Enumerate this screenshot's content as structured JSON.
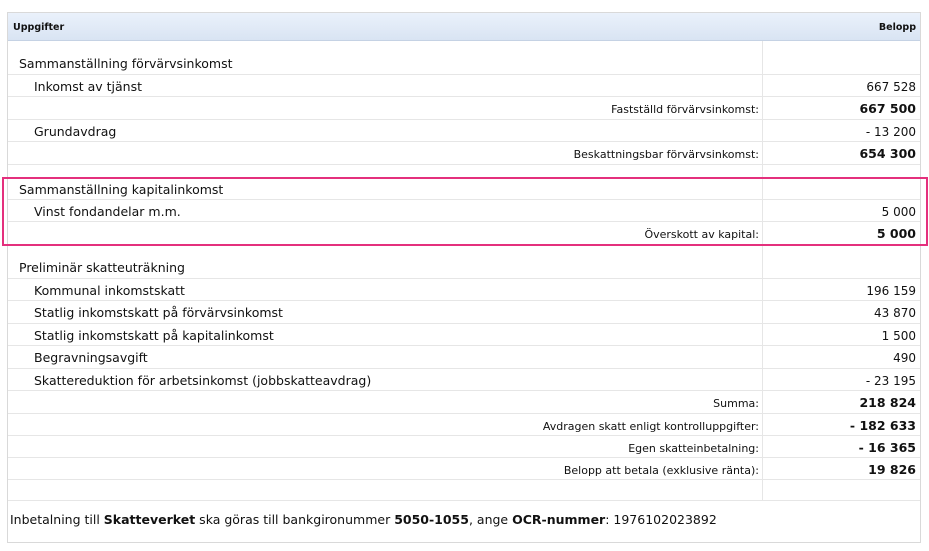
{
  "header": {
    "left": "Uppgifter",
    "right": "Belopp"
  },
  "colors": {
    "highlight_border": "#e4307d",
    "header_bg": "#dfe8f5"
  },
  "rows": [
    {
      "label": "Sammanställning förvärvsinkomst",
      "sub": "",
      "value": ""
    },
    {
      "label": "Inkomst av tjänst",
      "sub": "",
      "value": "667 528"
    },
    {
      "label": "",
      "sub": "Fastställd förvärvsinkomst:",
      "value": "667 500"
    },
    {
      "label": "Grundavdrag",
      "sub": "",
      "value": "- 13 200"
    },
    {
      "label": "",
      "sub": "Beskattningsbar förvärvsinkomst:",
      "value": "654 300"
    },
    {
      "label": "Sammanställning kapitalinkomst",
      "sub": "",
      "value": ""
    },
    {
      "label": "Vinst fondandelar m.m.",
      "sub": "",
      "value": "5 000"
    },
    {
      "label": "",
      "sub": "Överskott av kapital:",
      "value": "5 000"
    },
    {
      "label": "Preliminär skatteuträkning",
      "sub": "",
      "value": ""
    },
    {
      "label": "Kommunal inkomstskatt",
      "sub": "",
      "value": "196 159"
    },
    {
      "label": "Statlig inkomstskatt på förvärvsinkomst",
      "sub": "",
      "value": "43 870"
    },
    {
      "label": "Statlig inkomstskatt på kapitalinkomst",
      "sub": "",
      "value": "1 500"
    },
    {
      "label": "Begravningsavgift",
      "sub": "",
      "value": "490"
    },
    {
      "label": "Skattereduktion för arbetsinkomst (jobbskatteavdrag)",
      "sub": "",
      "value": "- 23 195"
    },
    {
      "label": "",
      "sub": "Summa:",
      "value": "218 824"
    },
    {
      "label": "",
      "sub": "Avdragen skatt enligt kontrolluppgifter:",
      "value": "- 182 633"
    },
    {
      "label": "",
      "sub": "Egen skatteinbetalning:",
      "value": "- 16 365"
    },
    {
      "label": "",
      "sub": "Belopp att betala (exklusive ränta):",
      "value": "19 826"
    }
  ],
  "footer": {
    "part1": "Inbetalning till ",
    "agency": "Skatteverket",
    "part2": " ska göras till bankgironummer ",
    "bankgiro": "5050-1055",
    "part3": ", ange ",
    "ocr_label": "OCR-nummer",
    "part4": ": ",
    "ocr_number": "1976102023892"
  }
}
